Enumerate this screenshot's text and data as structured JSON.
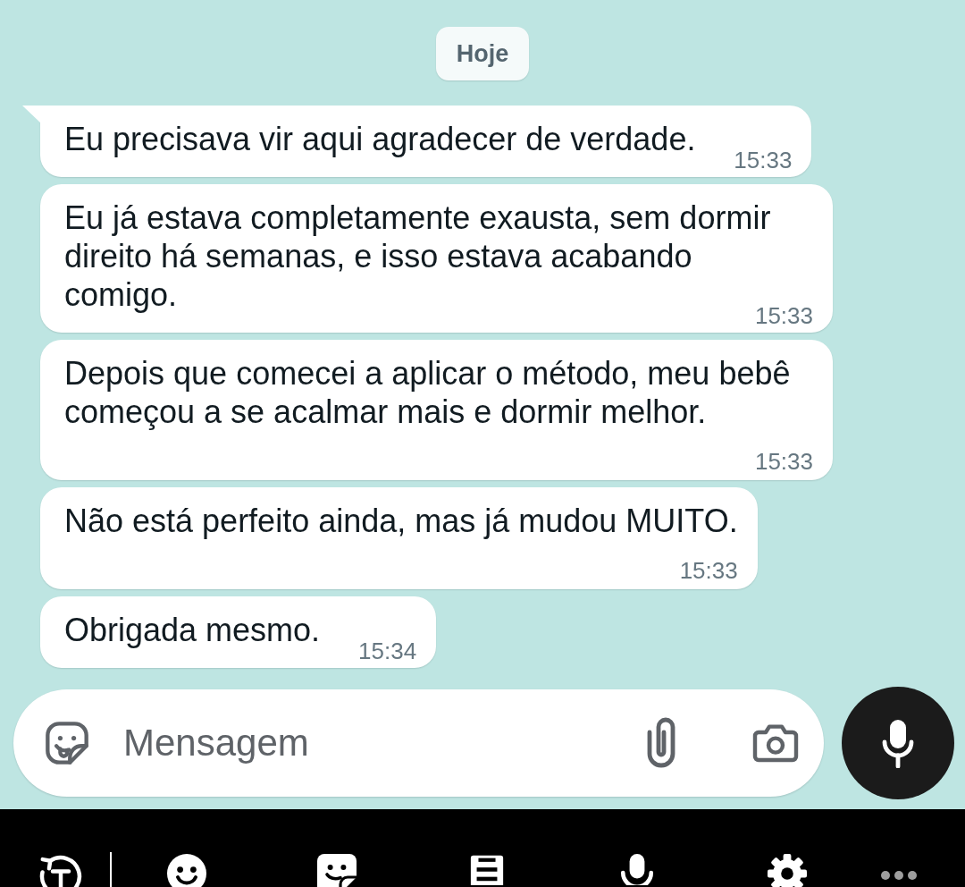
{
  "date_separator": {
    "label": "Hoje"
  },
  "messages": [
    {
      "kind": "inline",
      "tail": true,
      "text": "Eu precisava vir aqui agradecer de verdade.",
      "time": "15:33"
    },
    {
      "kind": "inline",
      "tail": false,
      "text": "Eu já estava completamente exausta, sem dormir direito há semanas, e isso estava acabando comigo.",
      "time": "15:33"
    },
    {
      "kind": "stacked",
      "tail": false,
      "text": "Depois que comecei a aplicar o método, meu bebê começou a se acalmar mais e dormir melhor.",
      "time": "15:33"
    },
    {
      "kind": "stacked",
      "tail": false,
      "text": "Não está perfeito ainda, mas já mudou MUITO.",
      "time": "15:33"
    },
    {
      "kind": "inline",
      "tail": false,
      "text": "Obrigada mesmo.",
      "time": "15:34"
    }
  ],
  "composer": {
    "placeholder": "Mensagem"
  }
}
